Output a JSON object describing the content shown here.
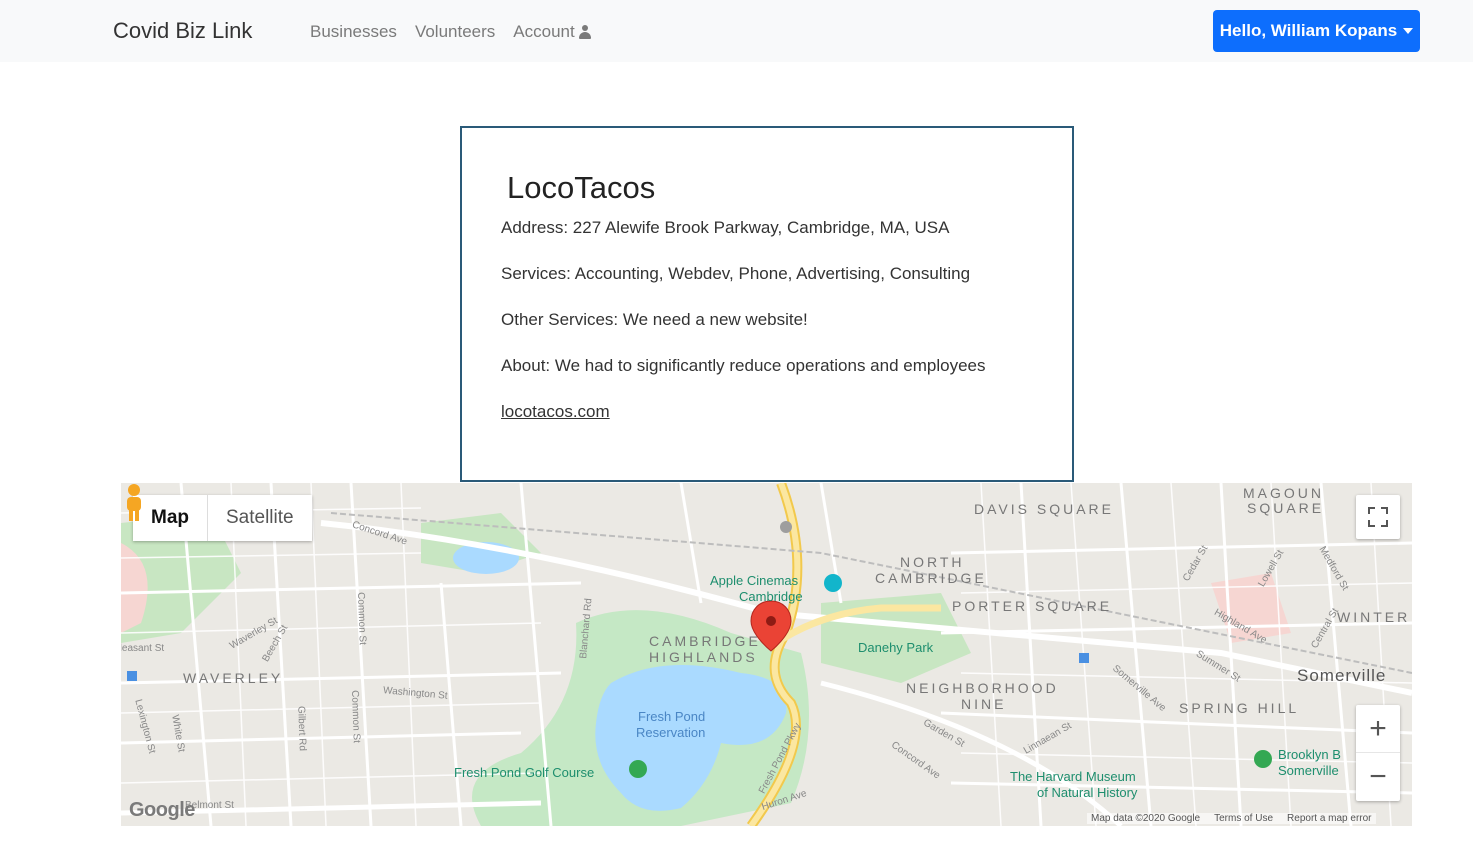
{
  "navbar": {
    "brand": "Covid Biz Link",
    "links": [
      "Businesses",
      "Volunteers",
      "Account"
    ],
    "user_button": "Hello, William Kopans"
  },
  "business": {
    "name": "LocoTacos",
    "address": "Address: 227 Alewife Brook Parkway, Cambridge, MA, USA",
    "services": "Services: Accounting, Webdev, Phone, Advertising, Consulting",
    "other_services": "Other Services: We need a new website!",
    "about": "About: We had to significantly reduce operations and employees",
    "website": "locotacos.com"
  },
  "map": {
    "type_map": "Map",
    "type_satellite": "Satellite",
    "zoom_in": "+",
    "zoom_out": "−",
    "labels": {
      "davis_square": "DAVIS SQUARE",
      "magoun_square_1": "MAGOUN",
      "magoun_square_2": "SQUARE",
      "north_cambridge_1": "NORTH",
      "north_cambridge_2": "CAMBRIDGE",
      "porter_square": "PORTER SQUARE",
      "winter": "WINTER",
      "somerville": "Somerville",
      "cambridge_highlands_1": "CAMBRIDGE",
      "cambridge_highlands_2": "HIGHLANDS",
      "waverley": "WAVERLEY",
      "neighborhood_nine_1": "NEIGHBORHOOD",
      "neighborhood_nine_2": "NINE",
      "spring_hill": "SPRING HILL",
      "apple_cinemas_1": "Apple Cinemas",
      "apple_cinemas_2": "Cambridge",
      "danehy_park": "Danehy Park",
      "fresh_pond_1": "Fresh Pond",
      "fresh_pond_2": "Reservation",
      "golf_course": "Fresh Pond Golf Course",
      "harvard_museum_1": "The Harvard Museum",
      "harvard_museum_2": "of Natural History",
      "brooklyn_1": "Brooklyn B",
      "brooklyn_2": "Somerville",
      "concord_ave": "Concord Ave",
      "washington_st": "Washington St",
      "fresh_pond_pkwy": "Fresh Pond Pkwy",
      "huron_ave": "Huron Ave",
      "somerville_ave": "Somerville Ave",
      "highland_ave": "Highland Ave",
      "summer_st": "Summer St",
      "garden_st": "Garden St",
      "linnaean_st": "Linnaean St",
      "lexington_st": "Lexington St",
      "common_st": "Common St",
      "belmont_st": "Belmont St",
      "gilbert_rd": "Gilbert Rd",
      "white_st": "White St",
      "cedar_st": "Cedar St",
      "lowell_st": "Lowell St",
      "medford_st": "Medford St",
      "central_st": "Central St",
      "blanchard_rd": "Blanchard Rd",
      "pleasant_st": "Pleasant St",
      "waverley_st": "Waverley St",
      "beech_st": "Beech St"
    },
    "google": "Google",
    "map_data": "Map data ©2020 Google",
    "terms": "Terms of Use",
    "report": "Report a map error"
  },
  "colors": {
    "accent": "#0d6efd",
    "card_border": "#2a5a78",
    "water": "#aadaff",
    "park": "#c5e8c5",
    "highway": "#f9e6a4",
    "marker": "#ea4335"
  }
}
